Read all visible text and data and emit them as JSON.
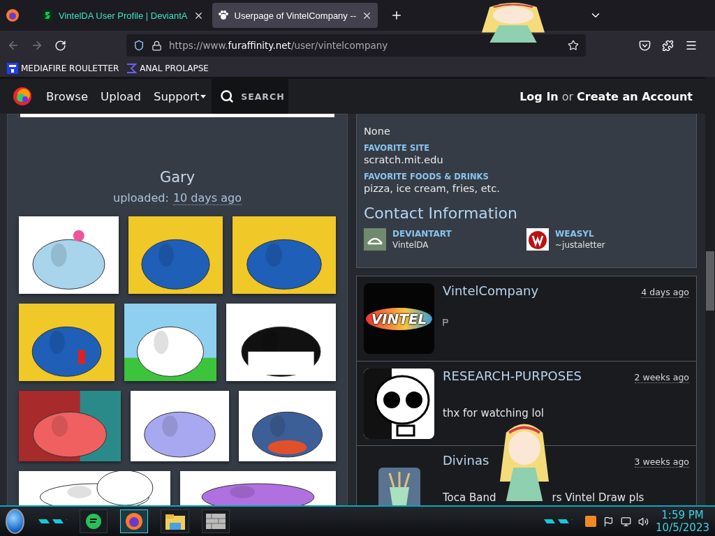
{
  "browser": {
    "tabs": [
      {
        "title": "VintelDA User Profile | DeviantA",
        "selected": false,
        "kind": "deviantart"
      },
      {
        "title": "Userpage of VintelCompany --",
        "selected": true,
        "kind": "furaffinity"
      }
    ],
    "url": {
      "prefix": "https://www.",
      "domain": "furaffinity.net",
      "path": "/user/vintelcompany"
    },
    "bookmarks": [
      {
        "label": "MEDIAFIRE ROULETTER",
        "kind": "mediafire"
      },
      {
        "label": "ANAL PROLAPSE",
        "kind": "sigma"
      }
    ]
  },
  "site_header": {
    "nav": [
      {
        "label": "Browse",
        "dropdown": false
      },
      {
        "label": "Upload",
        "dropdown": false
      },
      {
        "label": "Support",
        "dropdown": true
      }
    ],
    "search": {
      "placeholder": "SEARCH"
    },
    "login": "Log In",
    "separator": "or",
    "create_account": "Create an Account"
  },
  "submission": {
    "title": "Gary",
    "uploaded_label": "uploaded:",
    "uploaded_time": "10 days ago"
  },
  "profile": {
    "fields": [
      {
        "value": "None"
      },
      {
        "label": "FAVORITE SITE",
        "value": "scratch.mit.edu"
      },
      {
        "label": "FAVORITE FOODS & DRINKS",
        "value": "pizza, ice cream, fries, etc."
      }
    ],
    "contact_title": "Contact Information",
    "contacts": [
      {
        "site": "DEVIANTART",
        "handle": "VintelDA",
        "kind": "deviantart"
      },
      {
        "site": "WEASYL",
        "handle": "~justaletter",
        "kind": "weasyl"
      }
    ]
  },
  "watchers": [
    {
      "name": "VintelCompany",
      "time": "4 days ago",
      "avatar": {
        "kind": "logo",
        "text": "VINTEL"
      },
      "comment": {
        "kind": "glyph"
      }
    },
    {
      "name": "RESEARCH-PURPOSES",
      "time": "2 weeks ago",
      "avatar": {
        "kind": "skull"
      },
      "comment": {
        "kind": "text",
        "parts": [
          "thx for watching lol"
        ]
      }
    },
    {
      "name": "Divinas",
      "time": "3 weeks ago",
      "avatar": {
        "kind": "brushes"
      },
      "comment": {
        "kind": "text",
        "parts": [
          "Toca Band",
          "rs Vintel Draw pls"
        ]
      }
    }
  ],
  "taskbar": {
    "time": "1:59 PM",
    "date": "10/5/2023"
  }
}
